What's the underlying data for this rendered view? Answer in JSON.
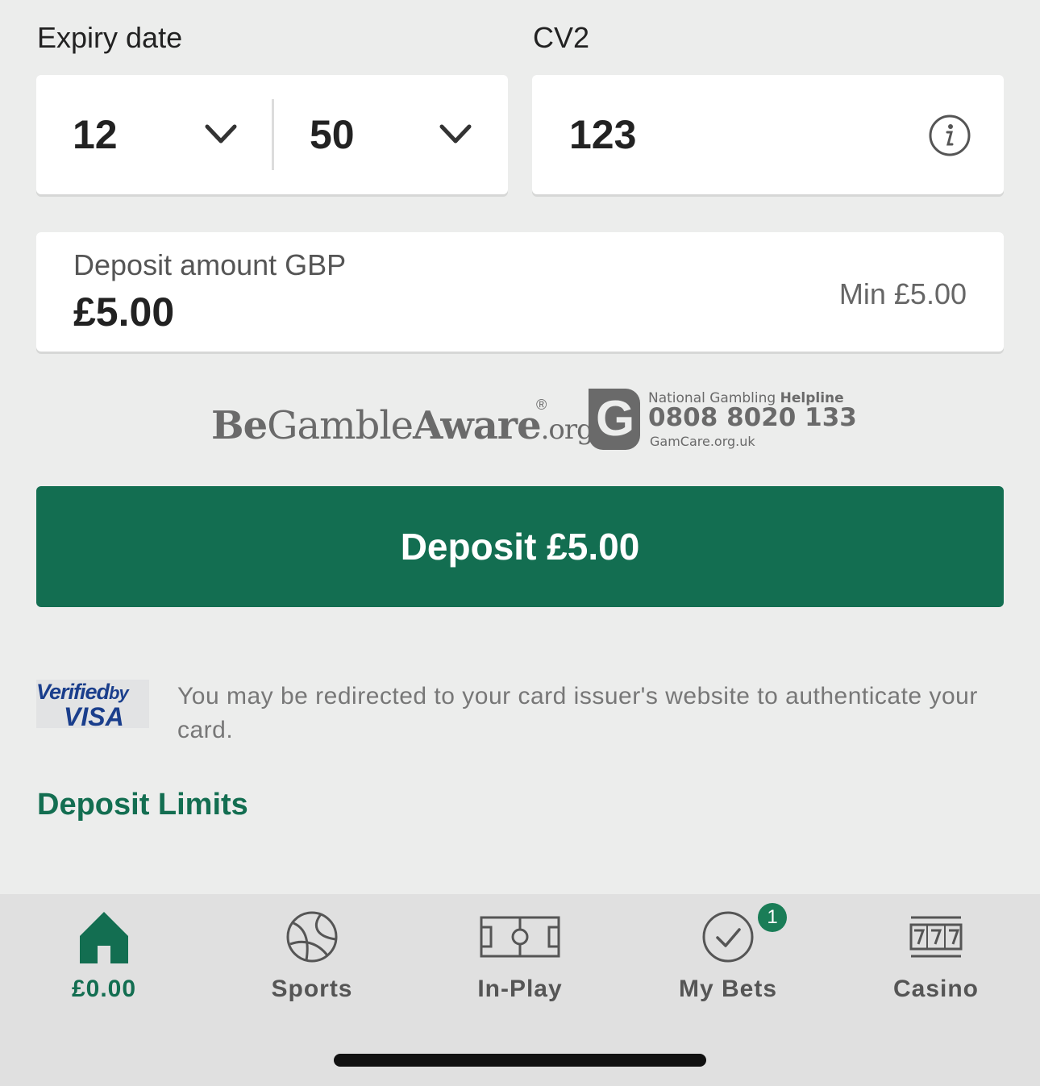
{
  "expiry": {
    "label": "Expiry date",
    "month": "12",
    "year": "50"
  },
  "cv2": {
    "label": "CV2",
    "value": "123"
  },
  "deposit_amount": {
    "label": "Deposit amount GBP",
    "value": "£5.00",
    "min": "Min £5.00"
  },
  "responsible": {
    "begambleaware": {
      "be": "Be",
      "gamble": "Gamble",
      "aware": "Aware",
      "org": ".org",
      "reg": "®"
    },
    "gamcare": {
      "helpline_label": "National Gambling",
      "helpline_bold": "Helpline",
      "phone": "0808 8020 133",
      "site": "GamCare.org.uk",
      "logo_letter": "G"
    }
  },
  "deposit_button": {
    "label": "Deposit £5.00",
    "color": "#136e51"
  },
  "verified_by_visa": {
    "logo": {
      "line1": "Verified",
      "by": "by",
      "line2": "VISA"
    },
    "note": "You may be redirected to your card issuer's website to authenticate your card."
  },
  "deposit_limits_link": "Deposit Limits",
  "tabbar": {
    "items": [
      {
        "label": "£0.00",
        "icon": "home-icon",
        "active": true
      },
      {
        "label": "Sports",
        "icon": "football-icon",
        "active": false
      },
      {
        "label": "In-Play",
        "icon": "pitch-icon",
        "active": false
      },
      {
        "label": "My Bets",
        "icon": "check-circle-icon",
        "active": false,
        "badge": "1"
      },
      {
        "label": "Casino",
        "icon": "slot-machine-icon",
        "active": false
      }
    ]
  }
}
